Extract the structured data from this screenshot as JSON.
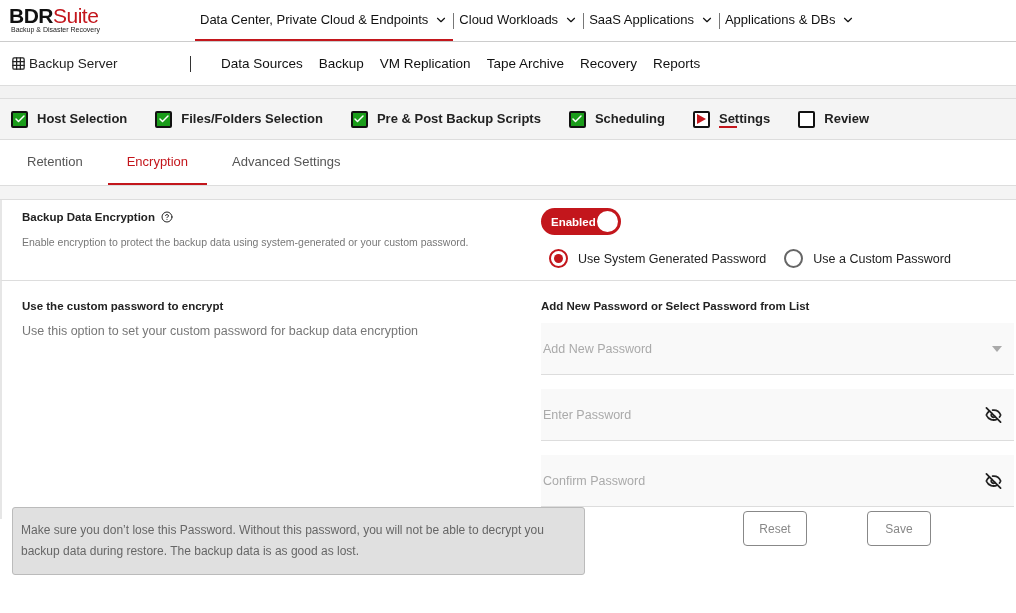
{
  "logo": {
    "brand_dark": "BDR",
    "brand_red": "Suite",
    "tagline": "Backup & Disaster Recovery"
  },
  "top_nav": [
    {
      "label": "Data Center, Private Cloud & Endpoints",
      "selected": true
    },
    {
      "label": "Cloud Workloads",
      "selected": false
    },
    {
      "label": "SaaS Applications",
      "selected": false
    },
    {
      "label": "Applications & DBs",
      "selected": false
    }
  ],
  "app_title": "Backup Server",
  "sub_nav": [
    "Data Sources",
    "Backup",
    "VM Replication",
    "Tape Archive",
    "Recovery",
    "Reports"
  ],
  "steps": [
    {
      "label": "Host Selection",
      "kind": "done",
      "selected": false
    },
    {
      "label": "Files/Folders Selection",
      "kind": "done",
      "selected": false
    },
    {
      "label": "Pre & Post Backup Scripts",
      "kind": "done",
      "selected": false
    },
    {
      "label": "Scheduling",
      "kind": "done",
      "selected": false
    },
    {
      "label": "Settings",
      "kind": "current",
      "selected": true
    },
    {
      "label": "Review",
      "kind": "pending",
      "selected": false
    }
  ],
  "tabs": [
    {
      "label": "Retention",
      "selected": false
    },
    {
      "label": "Encryption",
      "selected": true
    },
    {
      "label": "Advanced Settings",
      "selected": false
    }
  ],
  "encryption": {
    "title": "Backup Data Encryption",
    "description": "Enable encryption to protect the backup data using system-generated or your custom password.",
    "toggle": {
      "label": "Enabled",
      "on": true
    },
    "options": [
      {
        "label": "Use System Generated Password",
        "selected": true
      },
      {
        "label": "Use a Custom Password",
        "selected": false
      }
    ]
  },
  "custom": {
    "title": "Use the custom password to encrypt",
    "description": "Use this option to set your custom password for backup data encryption",
    "form_title": "Add New Password or Select Password from List",
    "fields": [
      {
        "kind": "select",
        "placeholder": "Add New Password"
      },
      {
        "kind": "password",
        "placeholder": "Enter Password"
      },
      {
        "kind": "password",
        "placeholder": "Confirm Password"
      }
    ]
  },
  "warning": "Make sure you don’t lose this Password. Without this password, you will not be able to decrypt you backup data during restore. The  backup data is as good as lost.",
  "buttons": [
    "Reset",
    "Save"
  ]
}
